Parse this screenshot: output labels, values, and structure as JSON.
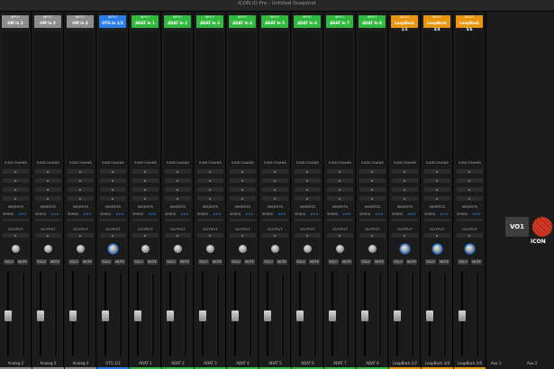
{
  "window": {
    "title": "ICON iO Pro - Untitled Snapshot"
  },
  "labels": {
    "sidechains": "SIDECHAINS",
    "inserts": "INSERTS",
    "sends": "SENDS",
    "sends_value": "###",
    "output": "OUTPUT",
    "solo": "SOLO",
    "mute": "MUTE"
  },
  "channels": [
    {
      "kind": "INPUT",
      "name": "HM In 2",
      "color": "#8d8d8d",
      "footer": "Analog 2",
      "knob_active": false
    },
    {
      "kind": "INPUT",
      "name": "HM In 3",
      "color": "#8d8d8d",
      "footer": "Analog 3",
      "knob_active": false
    },
    {
      "kind": "INPUT",
      "name": "HM In 4",
      "color": "#8d8d8d",
      "footer": "Analog 4",
      "knob_active": false
    },
    {
      "kind": "INPUT",
      "name": "OTG In 1/2",
      "color": "#2a7ee6",
      "footer": "OTG 1/2",
      "knob_active": true
    },
    {
      "kind": "INPUT",
      "name": "ADAT In 1",
      "color": "#32b83e",
      "footer": "ADAT 1",
      "knob_active": false
    },
    {
      "kind": "INPUT",
      "name": "ADAT In 2",
      "color": "#32b83e",
      "footer": "ADAT 2",
      "knob_active": false
    },
    {
      "kind": "INPUT",
      "name": "ADAT In 3",
      "color": "#32b83e",
      "footer": "ADAT 3",
      "knob_active": false
    },
    {
      "kind": "INPUT",
      "name": "ADAT In 4",
      "color": "#32b83e",
      "footer": "ADAT 4",
      "knob_active": false
    },
    {
      "kind": "INPUT",
      "name": "ADAT In 5",
      "color": "#32b83e",
      "footer": "ADAT 5",
      "knob_active": false
    },
    {
      "kind": "INPUT",
      "name": "ADAT In 6",
      "color": "#32b83e",
      "footer": "ADAT 6",
      "knob_active": false
    },
    {
      "kind": "INPUT",
      "name": "ADAT In 7",
      "color": "#32b83e",
      "footer": "ADAT 7",
      "knob_active": false
    },
    {
      "kind": "INPUT",
      "name": "ADAT In 8",
      "color": "#32b83e",
      "footer": "ADAT 8",
      "knob_active": false
    },
    {
      "kind": "INPUT",
      "name": "LoopBack 1/2",
      "color": "#e8960f",
      "footer": "LoopBack 1/2",
      "knob_active": true
    },
    {
      "kind": "INPUT",
      "name": "LoopBack 3/4",
      "color": "#e8960f",
      "footer": "LoopBack 3/4",
      "knob_active": true
    },
    {
      "kind": "INPUT",
      "name": "LoopBack 5/6",
      "color": "#e8960f",
      "footer": "LoopBack 5/6",
      "knob_active": true
    }
  ],
  "right_panel": {
    "badge": "VO1",
    "logo_text": "ICON",
    "aux1": "Aux 1",
    "aux2": "Aux 2"
  }
}
